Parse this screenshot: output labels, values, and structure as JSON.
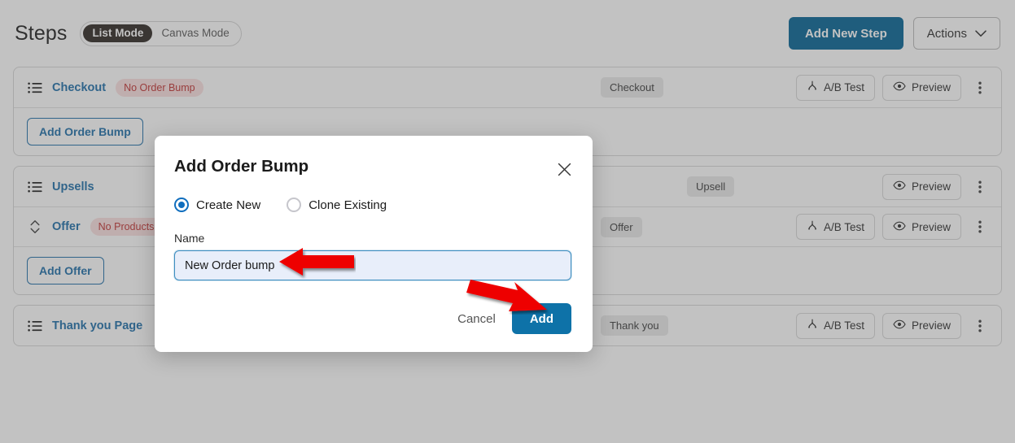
{
  "header": {
    "title": "Steps",
    "modes": [
      {
        "label": "List Mode",
        "active": true
      },
      {
        "label": "Canvas Mode",
        "active": false
      }
    ],
    "add_new_step_label": "Add New Step",
    "actions_label": "Actions",
    "actions_chevron_icon": "chevron-down-icon",
    "primary_color": "#006193"
  },
  "steps": [
    {
      "icon": "list-icon",
      "name": "Checkout",
      "badge": "No Order Bump",
      "type_chip": "Checkout",
      "ab_test_label": "A/B Test",
      "ab_test_icon": "ab-split-icon",
      "preview_label": "Preview",
      "preview_icon": "eye-icon",
      "menu_icon": "kebab-menu-icon",
      "sub_action_label": "Add Order Bump"
    },
    {
      "icon": "list-icon",
      "name": "Upsells",
      "badge": "",
      "type_chip": "Upsell",
      "ab_test_label": "",
      "preview_label": "Preview",
      "preview_icon": "eye-icon",
      "menu_icon": "kebab-menu-icon",
      "child": {
        "icon": "chevron-updown-icon",
        "name": "Offer",
        "badge": "No Products",
        "type_chip": "Offer",
        "ab_test_label": "A/B Test",
        "ab_test_icon": "ab-split-icon",
        "preview_label": "Preview",
        "preview_icon": "eye-icon",
        "menu_icon": "kebab-menu-icon"
      },
      "sub_action_label": "Add Offer"
    },
    {
      "icon": "list-icon",
      "name": "Thank you Page",
      "badge": "",
      "type_chip": "Thank you",
      "ab_test_label": "A/B Test",
      "ab_test_icon": "ab-split-icon",
      "preview_label": "Preview",
      "preview_icon": "eye-icon",
      "menu_icon": "kebab-menu-icon"
    }
  ],
  "modal": {
    "title": "Add Order Bump",
    "close_icon": "close-icon",
    "options": [
      {
        "label": "Create New",
        "selected": true
      },
      {
        "label": "Clone Existing",
        "selected": false
      }
    ],
    "name_label": "Name",
    "name_value": "New Order bump",
    "name_placeholder": "Name",
    "cancel_label": "Cancel",
    "add_label": "Add",
    "add_color": "#0e72a8"
  },
  "annotations": [
    {
      "name": "arrow-pointing-to-name-input",
      "direction": "left",
      "color": "#ee0000"
    },
    {
      "name": "arrow-pointing-to-add-button",
      "direction": "down-right",
      "color": "#ee0000"
    }
  ]
}
